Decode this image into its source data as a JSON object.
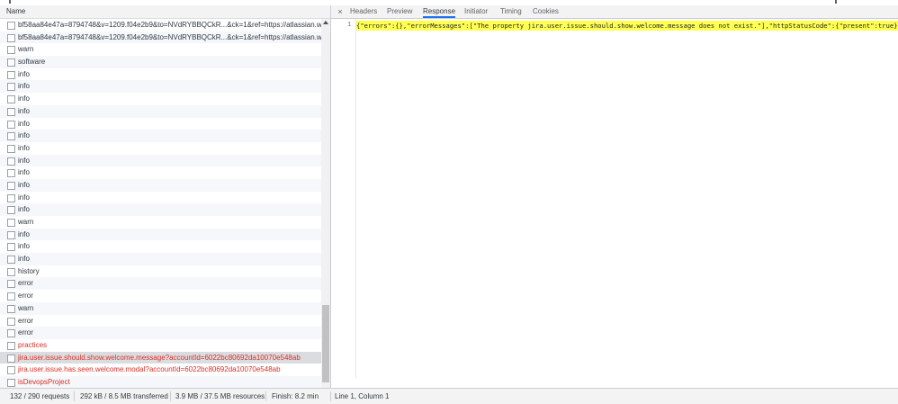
{
  "left_panel": {
    "name_header": "Name",
    "rows": [
      {
        "text": "bf58aa84e47a=8794748&v=1209.f04e2b9&to=NVdRYBBQCkR...&ck=1&ref=https://atlassian.wis...",
        "type": "normal"
      },
      {
        "text": "bf58aa84e47a=8794748&v=1209.f04e2b9&to=NVdRYBBQCkR...&ck=1&ref=https://atlassian.wis...",
        "type": "normal"
      },
      {
        "text": "warn",
        "type": "normal"
      },
      {
        "text": "software",
        "type": "normal"
      },
      {
        "text": "info",
        "type": "normal"
      },
      {
        "text": "info",
        "type": "normal"
      },
      {
        "text": "info",
        "type": "normal"
      },
      {
        "text": "info",
        "type": "normal"
      },
      {
        "text": "info",
        "type": "normal"
      },
      {
        "text": "info",
        "type": "normal"
      },
      {
        "text": "info",
        "type": "normal"
      },
      {
        "text": "info",
        "type": "normal"
      },
      {
        "text": "info",
        "type": "normal"
      },
      {
        "text": "info",
        "type": "normal"
      },
      {
        "text": "info",
        "type": "normal"
      },
      {
        "text": "info",
        "type": "normal"
      },
      {
        "text": "warn",
        "type": "normal"
      },
      {
        "text": "info",
        "type": "normal"
      },
      {
        "text": "info",
        "type": "normal"
      },
      {
        "text": "info",
        "type": "normal"
      },
      {
        "text": "history",
        "type": "normal"
      },
      {
        "text": "error",
        "type": "normal"
      },
      {
        "text": "error",
        "type": "normal"
      },
      {
        "text": "warn",
        "type": "normal"
      },
      {
        "text": "error",
        "type": "normal"
      },
      {
        "text": "error",
        "type": "normal"
      },
      {
        "text": "practices",
        "type": "error"
      },
      {
        "text": "jira.user.issue.should.show.welcome.message?accountId=6022bc80692da10070e548ab",
        "type": "selected-error"
      },
      {
        "text": "jira.user.issue.has.seen.welcome.modal?accountId=6022bc80692da10070e548ab",
        "type": "error"
      },
      {
        "text": "isDevopsProject",
        "type": "error"
      }
    ]
  },
  "right_panel": {
    "close_symbol": "×",
    "tabs": [
      "Headers",
      "Preview",
      "Response",
      "Initiator",
      "Timing",
      "Cookies"
    ],
    "active_tab": "Response",
    "response": {
      "line_number": "1",
      "content": "{\"errors\":{},\"errorMessages\":[\"The property jira.user.issue.should.show.welcome.message does not exist.\"],\"httpStatusCode\":{\"present\":true}"
    }
  },
  "status_bar": {
    "requests": "132 / 290 requests",
    "transferred": "292 kB / 8.5 MB transferred",
    "resources": "3.9 MB / 37.5 MB resources",
    "finish": "Finish: 8.2 min",
    "cursor": "Line 1, Column 1"
  },
  "colors": {
    "error_text": "#d93025",
    "selected_row": "#dadce0",
    "response_highlight": "#ffff52",
    "active_tab_underline": "#1a73e8"
  }
}
